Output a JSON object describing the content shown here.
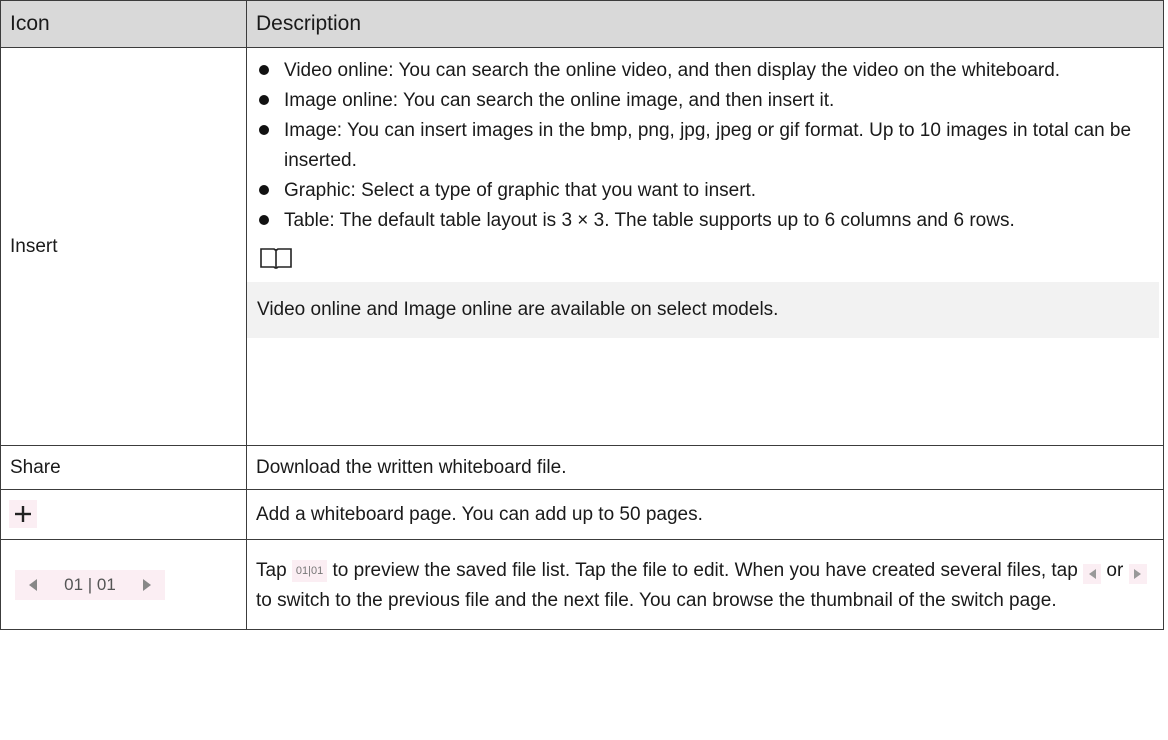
{
  "table": {
    "headers": {
      "icon": "Icon",
      "description": "Description"
    },
    "rows": {
      "insert": {
        "icon_label": "Insert",
        "bullets": [
          "Video online: You can search the online video, and then display the video on the whiteboard.",
          "Image online: You can search the online image, and then insert it.",
          "Image: You can insert images in the bmp, png, jpg, jpeg or gif format. Up to 10 images in total can be inserted.",
          "Graphic: Select a type of graphic that you want to insert.",
          "Table: The default table layout is 3 × 3. The table supports up to 6 columns and 6 rows."
        ],
        "note_icon": "book-icon",
        "note": "Video online and Image online are available on select models."
      },
      "share": {
        "icon_label": "Share",
        "description": "Download the written whiteboard file."
      },
      "add_page": {
        "icon": "plus-icon",
        "description": "Add a whiteboard page. You can add up to 50 pages."
      },
      "page_switch": {
        "pager_text": "01 | 01",
        "inline_chip_text": "01|01",
        "desc_part1": "Tap",
        "desc_part2": "to preview the saved file list. Tap the file to edit. When you have created several files, tap",
        "desc_part3": "or",
        "desc_part4": "to switch to the previous file and the next file. You can browse the thumbnail of the switch page."
      }
    }
  },
  "colors": {
    "header_bg": "#d9d9d9",
    "note_bg": "#f2f2f2",
    "icon_chip_bg": "#fbeef3",
    "border": "#3c3c3c"
  }
}
